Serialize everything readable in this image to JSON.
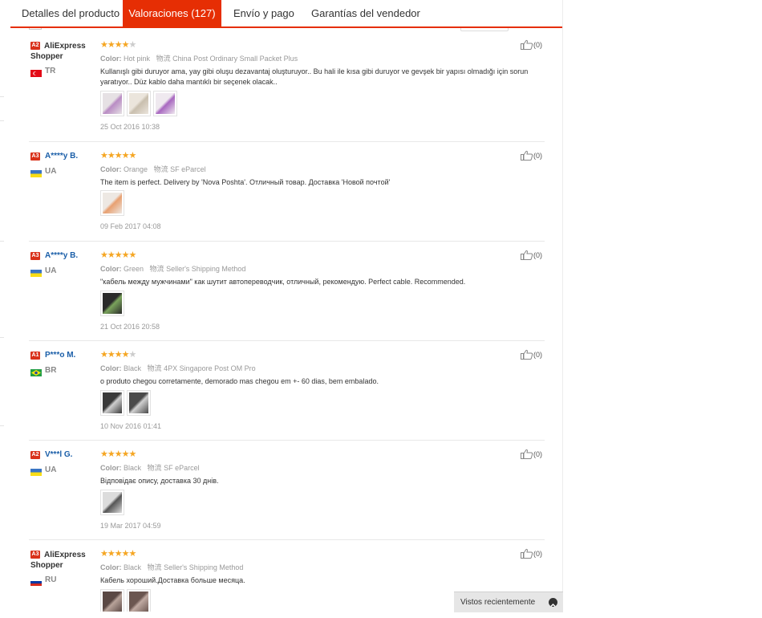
{
  "tabs": [
    {
      "label": "Detalles del producto",
      "active": false
    },
    {
      "label": "Valoraciones (127)",
      "active": true
    },
    {
      "label": "Envío y pago",
      "active": false
    },
    {
      "label": "Garantías del vendedor",
      "active": false
    }
  ],
  "labels": {
    "color": "Color:",
    "shipping": "物流",
    "like_count": "(0)"
  },
  "recently_viewed": "Vistos recientemente",
  "reviews": [
    {
      "badge": "A2",
      "name": "AliExpress Shopper",
      "country": "TR",
      "rating": 4,
      "color": "Hot pink",
      "shipping": "China Post Ordinary Small Packet Plus",
      "text": "Kullanışlı gibi duruyor ama, yay gibi oluşu dezavantaj oluşturuyor.. Bu hali ile kısa gibi duruyor ve gevşek bir yapısı olmadığı için sorun yaratıyor.. Düz kablo daha mantıklı bir seçenek olacak..",
      "photos": 3,
      "date": "25 Oct 2016 10:38",
      "likes": "(0)"
    },
    {
      "badge": "A3",
      "name": "A****y B.",
      "country": "UA",
      "rating": 5,
      "color": "Orange",
      "shipping": "SF eParcel",
      "text": "The item is perfect. Delivery by 'Nova Poshta'. Отличный товар. Доставка 'Новой почтой'",
      "photos": 1,
      "date": "09 Feb 2017 04:08",
      "likes": "(0)"
    },
    {
      "badge": "A3",
      "name": "A****y B.",
      "country": "UA",
      "rating": 5,
      "color": "Green",
      "shipping": "Seller's Shipping Method",
      "text": "\"кабель между мужчинами\" как шутит автопереводчик, отличный, рекомендую. Perfect cable. Recommended.",
      "photos": 1,
      "date": "21 Oct 2016 20:58",
      "likes": "(0)"
    },
    {
      "badge": "A1",
      "name": "P***o M.",
      "country": "BR",
      "rating": 4,
      "color": "Black",
      "shipping": "4PX Singapore Post OM Pro",
      "text": "o produto chegou corretamente, demorado mas chegou em +- 60 dias, bem embalado.",
      "photos": 2,
      "date": "10 Nov 2016 01:41",
      "likes": "(0)"
    },
    {
      "badge": "A2",
      "name": "V***l G.",
      "country": "UA",
      "rating": 5,
      "color": "Black",
      "shipping": "SF eParcel",
      "text": "Відповідає опису, доставка 30 днів.",
      "photos": 1,
      "date": "19 Mar 2017 04:59",
      "likes": "(0)"
    },
    {
      "badge": "A3",
      "name": "AliExpress Shopper",
      "country": "RU",
      "rating": 5,
      "color": "Black",
      "shipping": "Seller's Shipping Method",
      "text": "Кабель хороший.Доставка больше месяца.",
      "photos": 2,
      "date": "",
      "likes": "(0)"
    }
  ],
  "colors": {
    "accent": "#e62e04",
    "link": "#1a5ea8",
    "star": "#f5a623",
    "badge": "#d9321b"
  }
}
